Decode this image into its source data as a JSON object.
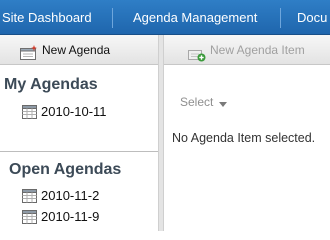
{
  "top_nav": {
    "items": [
      "Site Dashboard",
      "Agenda Management",
      "Docu"
    ]
  },
  "left_toolbar": {
    "new_agenda_label": "New Agenda"
  },
  "right_toolbar": {
    "new_agenda_item_label": "New Agenda Item"
  },
  "my_agendas": {
    "title": "My Agendas",
    "items": [
      "2010-10-11"
    ]
  },
  "open_agendas": {
    "title": "Open Agendas",
    "items": [
      "2010-11-2",
      "2010-11-9"
    ]
  },
  "detail": {
    "select_label": "Select",
    "empty_message": "No Agenda Item selected."
  },
  "colors": {
    "nav_background": "#2a76c0",
    "section_header": "#3c4a57",
    "disabled_text": "#a0a0a0",
    "add_icon_green": "#3a9a3a",
    "new_icon_red": "#d23a2a"
  },
  "icons": {
    "new_agenda": "new-document-icon",
    "new_agenda_item": "add-item-icon",
    "agenda": "calendar-icon",
    "select_caret": "caret-down-icon"
  }
}
